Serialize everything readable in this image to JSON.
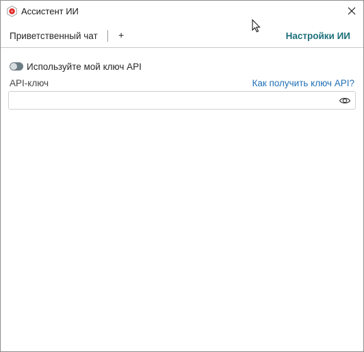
{
  "window": {
    "title": "Ассистент ИИ"
  },
  "tabs": {
    "chat_label": "Приветственный чат",
    "add_label": "+",
    "settings_label": "Настройки ИИ"
  },
  "settings": {
    "use_own_key_label": "Используйте мой ключ API",
    "use_own_key_enabled": false,
    "api_key_label": "API-ключ",
    "api_key_help_link": "Как получить ключ API?",
    "api_key_value": "",
    "api_key_placeholder": ""
  },
  "icons": {
    "app": "app-logo-icon",
    "close": "close-icon",
    "visibility": "eye-icon"
  },
  "colors": {
    "accent": "#1b6f7a",
    "link": "#1f6fb6",
    "app_icon_red": "#e02020"
  }
}
